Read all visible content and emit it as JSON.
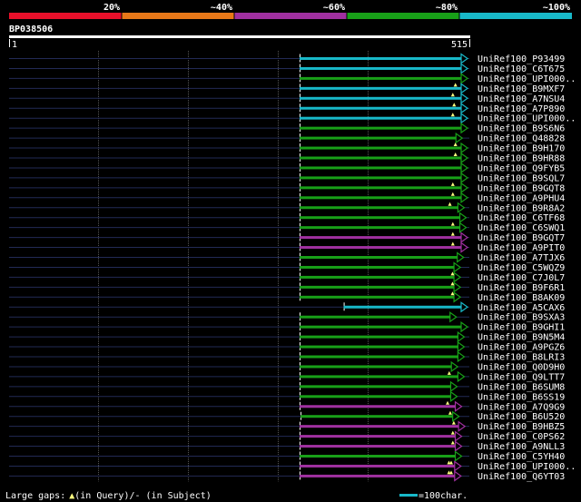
{
  "identity_scale": {
    "ticks": [
      "20%",
      "~40%",
      "~60%",
      "~80%",
      "~100%"
    ],
    "colors": [
      "#e8102a",
      "#e87818",
      "#a030a0",
      "#18a018",
      "#18b8c8"
    ]
  },
  "query": {
    "id": "BP038506",
    "start_label": "1",
    "end_label": "515",
    "length": 515
  },
  "hits": [
    {
      "label": "UniRef100_P93499",
      "color": "#18b8c8",
      "start": 1,
      "end": 515,
      "gaps": []
    },
    {
      "label": "UniRef100_C6T675",
      "color": "#18b8c8",
      "start": 1,
      "end": 515,
      "gaps": []
    },
    {
      "label": "UniRef100_UPI000..",
      "color": "#18a018",
      "start": 1,
      "end": 515,
      "gaps": []
    },
    {
      "label": "UniRef100_B9MXF7",
      "color": "#18b8c8",
      "start": 1,
      "end": 515,
      "gaps": [
        478
      ]
    },
    {
      "label": "UniRef100_A7NSU4",
      "color": "#18b8c8",
      "start": 1,
      "end": 515,
      "gaps": [
        470
      ]
    },
    {
      "label": "UniRef100_A7P890",
      "color": "#18b8c8",
      "start": 1,
      "end": 515,
      "gaps": [
        474
      ]
    },
    {
      "label": "UniRef100_UPI000..",
      "color": "#18b8c8",
      "start": 1,
      "end": 515,
      "gaps": [
        470
      ]
    },
    {
      "label": "UniRef100_B9S6N6",
      "color": "#18a018",
      "start": 1,
      "end": 515,
      "gaps": []
    },
    {
      "label": "UniRef100_Q48828",
      "color": "#18a018",
      "start": 1,
      "end": 499,
      "gaps": []
    },
    {
      "label": "UniRef100_B9H170",
      "color": "#18a018",
      "start": 1,
      "end": 515,
      "gaps": [
        478
      ]
    },
    {
      "label": "UniRef100_B9HR88",
      "color": "#18a018",
      "start": 1,
      "end": 515,
      "gaps": [
        478
      ]
    },
    {
      "label": "UniRef100_Q9FYB5",
      "color": "#18a018",
      "start": 1,
      "end": 515,
      "gaps": []
    },
    {
      "label": "UniRef100_B9SQL7",
      "color": "#18a018",
      "start": 1,
      "end": 515,
      "gaps": []
    },
    {
      "label": "UniRef100_B9GQT8",
      "color": "#18a018",
      "start": 1,
      "end": 515,
      "gaps": [
        470
      ]
    },
    {
      "label": "UniRef100_A9PHU4",
      "color": "#18a018",
      "start": 1,
      "end": 515,
      "gaps": [
        470
      ]
    },
    {
      "label": "UniRef100_B9R8A2",
      "color": "#18a018",
      "start": 1,
      "end": 505,
      "gaps": [
        461
      ]
    },
    {
      "label": "UniRef100_C6TF68",
      "color": "#18a018",
      "start": 1,
      "end": 511,
      "gaps": []
    },
    {
      "label": "UniRef100_C6SWQ1",
      "color": "#18a018",
      "start": 1,
      "end": 511,
      "gaps": [
        470
      ]
    },
    {
      "label": "UniRef100_B9GQT7",
      "color": "#a030a0",
      "start": 1,
      "end": 515,
      "gaps": [
        470
      ]
    },
    {
      "label": "UniRef100_A9PIT0",
      "color": "#a030a0",
      "start": 1,
      "end": 515,
      "gaps": [
        470
      ]
    },
    {
      "label": "UniRef100_A7TJX6",
      "color": "#18a018",
      "start": 1,
      "end": 503,
      "gaps": []
    },
    {
      "label": "UniRef100_C5WQZ9",
      "color": "#18a018",
      "start": 1,
      "end": 493,
      "gaps": []
    },
    {
      "label": "UniRef100_C7J0L7",
      "color": "#18a018",
      "start": 1,
      "end": 493,
      "gaps": [
        469
      ]
    },
    {
      "label": "UniRef100_B9F6R1",
      "color": "#18a018",
      "start": 1,
      "end": 493,
      "gaps": [
        469
      ]
    },
    {
      "label": "UniRef100_B8AK09",
      "color": "#18a018",
      "start": 1,
      "end": 493,
      "gaps": [
        469
      ]
    },
    {
      "label": "UniRef100_A5CAX6",
      "color": "#18b8c8",
      "start": 136,
      "end": 515,
      "gaps": []
    },
    {
      "label": "UniRef100_B9SXA3",
      "color": "#18a018",
      "start": 1,
      "end": 481,
      "gaps": []
    },
    {
      "label": "UniRef100_B9GHI1",
      "color": "#18a018",
      "start": 1,
      "end": 515,
      "gaps": []
    },
    {
      "label": "UniRef100_B9N5M4",
      "color": "#18a018",
      "start": 1,
      "end": 505,
      "gaps": []
    },
    {
      "label": "UniRef100_A9PGZ6",
      "color": "#18a018",
      "start": 1,
      "end": 505,
      "gaps": []
    },
    {
      "label": "UniRef100_B8LRI3",
      "color": "#18a018",
      "start": 1,
      "end": 505,
      "gaps": []
    },
    {
      "label": "UniRef100_Q0D9H0",
      "color": "#18a018",
      "start": 1,
      "end": 485,
      "gaps": []
    },
    {
      "label": "UniRef100_Q9LTT7",
      "color": "#18a018",
      "start": 1,
      "end": 505,
      "gaps": [
        459
      ]
    },
    {
      "label": "UniRef100_B6SUM8",
      "color": "#18a018",
      "start": 1,
      "end": 483,
      "gaps": []
    },
    {
      "label": "UniRef100_B6SS19",
      "color": "#18a018",
      "start": 1,
      "end": 483,
      "gaps": []
    },
    {
      "label": "UniRef100_A7Q9G9",
      "color": "#a030a0",
      "start": 1,
      "end": 497,
      "gaps": [
        454
      ]
    },
    {
      "label": "UniRef100_B6U520",
      "color": "#18a018",
      "start": 4,
      "end": 489,
      "gaps": [
        462
      ]
    },
    {
      "label": "UniRef100_B9HBZ5",
      "color": "#a030a0",
      "start": 1,
      "end": 507,
      "gaps": [
        473
      ]
    },
    {
      "label": "UniRef100_C0PS62",
      "color": "#a030a0",
      "start": 1,
      "end": 497,
      "gaps": [
        470
      ]
    },
    {
      "label": "UniRef100_A9NLL3",
      "color": "#a030a0",
      "start": 1,
      "end": 497,
      "gaps": [
        470
      ]
    },
    {
      "label": "UniRef100_C5YH40",
      "color": "#18a018",
      "start": 1,
      "end": 497,
      "gaps": []
    },
    {
      "label": "UniRef100_UPI000..",
      "color": "#a030a0",
      "start": 1,
      "end": 495,
      "gaps": [
        458,
        465
      ]
    },
    {
      "label": "UniRef100_Q6YT03",
      "color": "#a030a0",
      "start": 1,
      "end": 495,
      "gaps": [
        458,
        465
      ]
    }
  ],
  "legend": {
    "gaps_text_prefix": "Large gaps:",
    "gaps_text_query": "(in Query)/",
    "gaps_text_subject": "- (in Subject)",
    "scale_text": "=100char.",
    "scale_color": "#18b8c8"
  }
}
